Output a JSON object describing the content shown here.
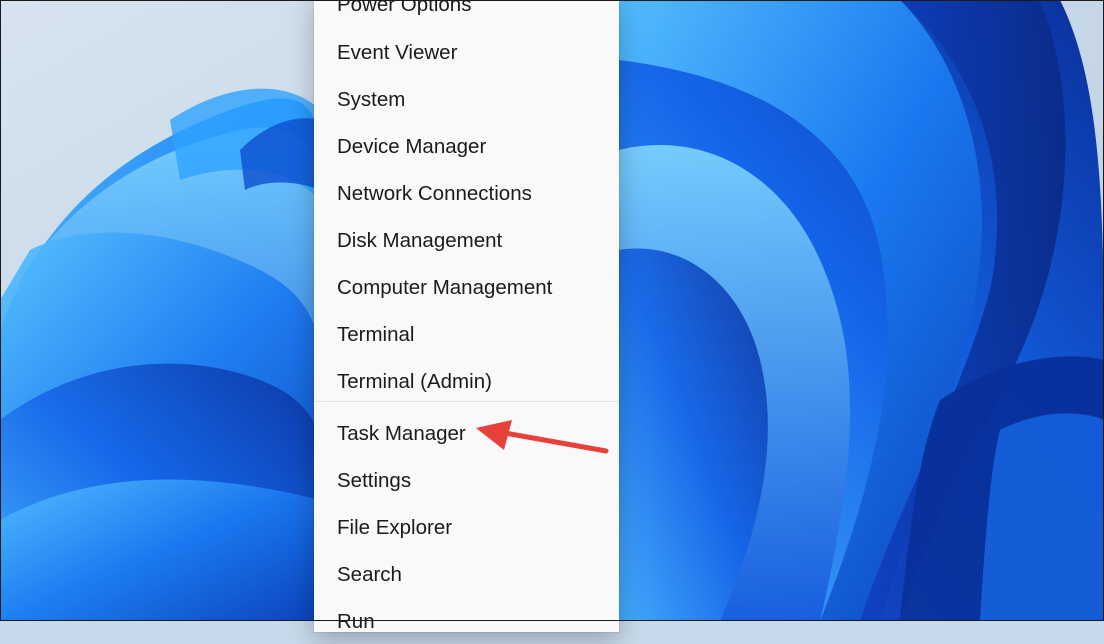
{
  "menu": {
    "items": [
      {
        "label": "Power Options",
        "name": "menu-item-power-options"
      },
      {
        "label": "Event Viewer",
        "name": "menu-item-event-viewer"
      },
      {
        "label": "System",
        "name": "menu-item-system"
      },
      {
        "label": "Device Manager",
        "name": "menu-item-device-manager"
      },
      {
        "label": "Network Connections",
        "name": "menu-item-network-connections"
      },
      {
        "label": "Disk Management",
        "name": "menu-item-disk-management"
      },
      {
        "label": "Computer Management",
        "name": "menu-item-computer-management"
      },
      {
        "label": "Terminal",
        "name": "menu-item-terminal"
      },
      {
        "label": "Terminal (Admin)",
        "name": "menu-item-terminal-admin"
      },
      {
        "label": "Task Manager",
        "name": "menu-item-task-manager"
      },
      {
        "label": "Settings",
        "name": "menu-item-settings"
      },
      {
        "label": "File Explorer",
        "name": "menu-item-file-explorer"
      },
      {
        "label": "Search",
        "name": "menu-item-search"
      },
      {
        "label": "Run",
        "name": "menu-item-run"
      }
    ],
    "highlighted_item": "Task Manager"
  },
  "annotation": {
    "arrow_color": "#e8413b",
    "points_to": "Task Manager"
  },
  "colors": {
    "menu_background": "#f9f9f9",
    "wallpaper_sky": "#c7d9ea",
    "wallpaper_blue": "#1a6ff0"
  }
}
